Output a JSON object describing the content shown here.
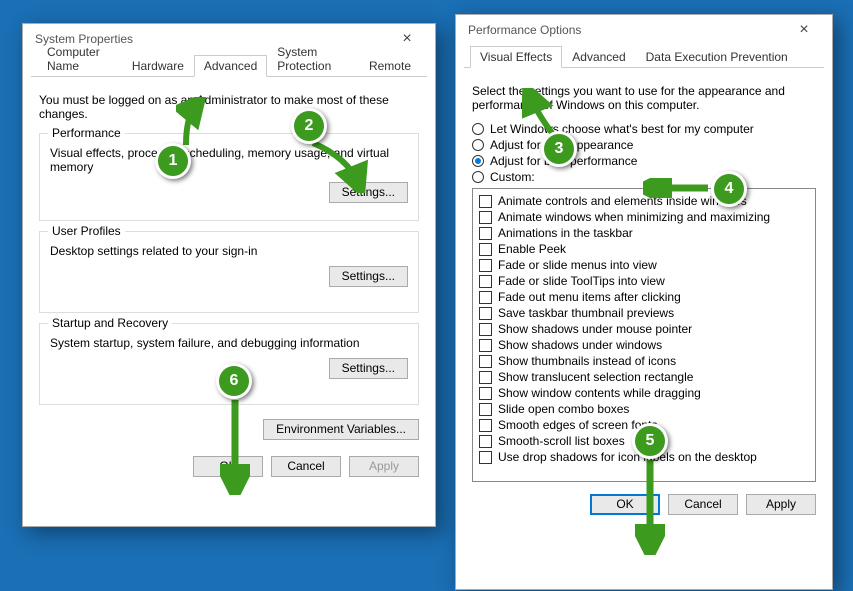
{
  "sysprops": {
    "title": "System Properties",
    "tabs": [
      "Computer Name",
      "Hardware",
      "Advanced",
      "System Protection",
      "Remote"
    ],
    "active_tab": 2,
    "intro": "You must be logged on as an Administrator to make most of these changes.",
    "groups": {
      "performance": {
        "legend": "Performance",
        "desc": "Visual effects, processor scheduling, memory usage, and virtual memory",
        "button": "Settings..."
      },
      "profiles": {
        "legend": "User Profiles",
        "desc": "Desktop settings related to your sign-in",
        "button": "Settings..."
      },
      "startup": {
        "legend": "Startup and Recovery",
        "desc": "System startup, system failure, and debugging information",
        "button": "Settings..."
      }
    },
    "env_button": "Environment Variables...",
    "buttons": {
      "ok": "OK",
      "cancel": "Cancel",
      "apply": "Apply"
    }
  },
  "perfopts": {
    "title": "Performance Options",
    "tabs": [
      "Visual Effects",
      "Advanced",
      "Data Execution Prevention"
    ],
    "active_tab": 0,
    "intro": "Select the settings you want to use for the appearance and performance of Windows on this computer.",
    "radios": [
      {
        "label": "Let Windows choose what's best for my computer",
        "checked": false
      },
      {
        "label": "Adjust for best appearance",
        "checked": false
      },
      {
        "label": "Adjust for best performance",
        "checked": true
      },
      {
        "label": "Custom:",
        "checked": false
      }
    ],
    "checks": [
      "Animate controls and elements inside windows",
      "Animate windows when minimizing and maximizing",
      "Animations in the taskbar",
      "Enable Peek",
      "Fade or slide menus into view",
      "Fade or slide ToolTips into view",
      "Fade out menu items after clicking",
      "Save taskbar thumbnail previews",
      "Show shadows under mouse pointer",
      "Show shadows under windows",
      "Show thumbnails instead of icons",
      "Show translucent selection rectangle",
      "Show window contents while dragging",
      "Slide open combo boxes",
      "Smooth edges of screen fonts",
      "Smooth-scroll list boxes",
      "Use drop shadows for icon labels on the desktop"
    ],
    "buttons": {
      "ok": "OK",
      "cancel": "Cancel",
      "apply": "Apply"
    }
  },
  "markers": [
    "1",
    "2",
    "3",
    "4",
    "5",
    "6"
  ]
}
